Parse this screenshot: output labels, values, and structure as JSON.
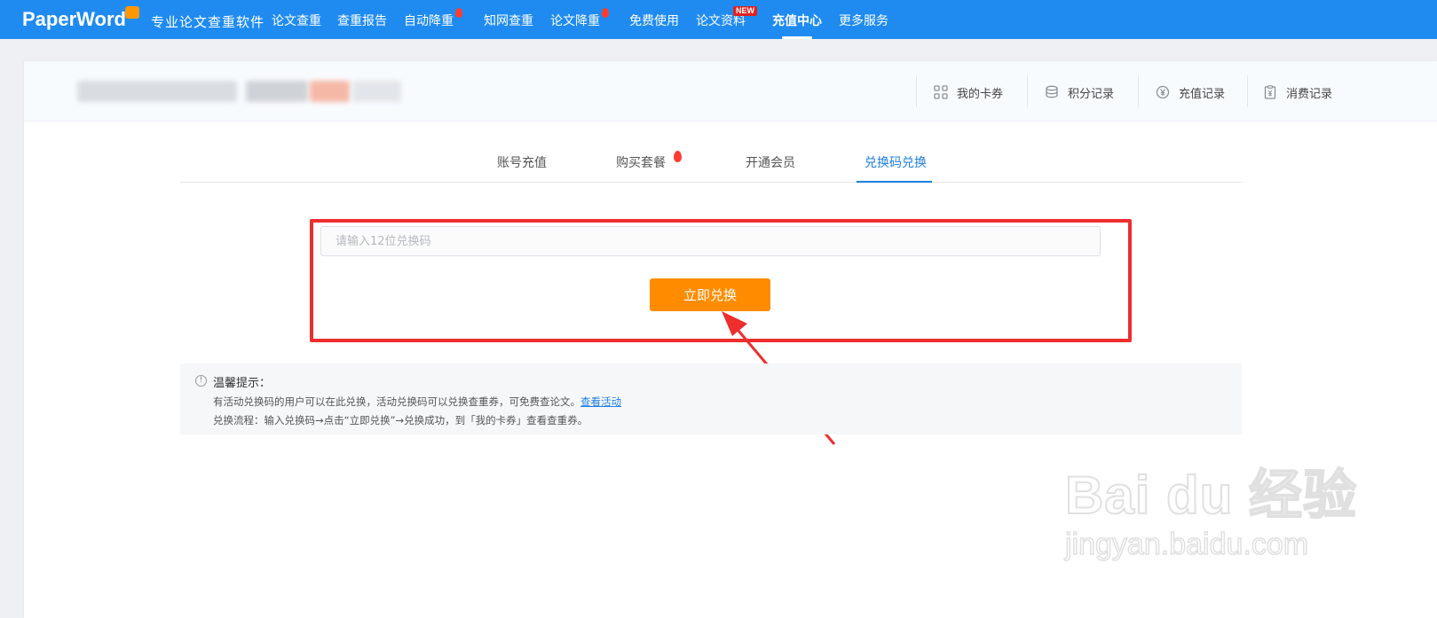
{
  "topbar": {
    "logo": "PaperWord",
    "slogan": "专业论文查重软件",
    "nav": [
      {
        "label": "论文查重"
      },
      {
        "label": "查重报告"
      },
      {
        "label": "自动降重"
      },
      {
        "label": "知网查重"
      },
      {
        "label": "论文降重"
      },
      {
        "label": "免费使用"
      },
      {
        "label": "论文资料"
      },
      {
        "label": "充值中心"
      },
      {
        "label": "更多服务"
      }
    ],
    "new_badge": "NEW"
  },
  "header_links": [
    {
      "label": "我的卡券",
      "icon": "grid-icon"
    },
    {
      "label": "积分记录",
      "icon": "coins-icon"
    },
    {
      "label": "充值记录",
      "icon": "yen-circle-icon"
    },
    {
      "label": "消费记录",
      "icon": "receipt-icon"
    }
  ],
  "tabs": [
    {
      "label": "账号充值"
    },
    {
      "label": "购买套餐"
    },
    {
      "label": "开通会员"
    },
    {
      "label": "兑换码兑换"
    }
  ],
  "redeem": {
    "placeholder": "请输入12位兑换码",
    "value": "",
    "button": "立即兑换"
  },
  "tips": {
    "icon": "!",
    "title": "温馨提示：",
    "line1": "有活动兑换码的用户可以在此兑换，活动兑换码可以兑换查重券，可免费查论文。",
    "link": "查看活动",
    "line2": "兑换流程：输入兑换码→点击“立即兑换”→兑换成功，到「我的卡券」查看查重券。"
  },
  "watermark": {
    "brand": "Bai du 经验",
    "url": "jingyan.baidu.com"
  },
  "colors": {
    "nav_bg": "#1f8bf0",
    "accent": "#1f7fe0",
    "button": "#ff8c00",
    "highlight_box": "#ee2d2d"
  }
}
